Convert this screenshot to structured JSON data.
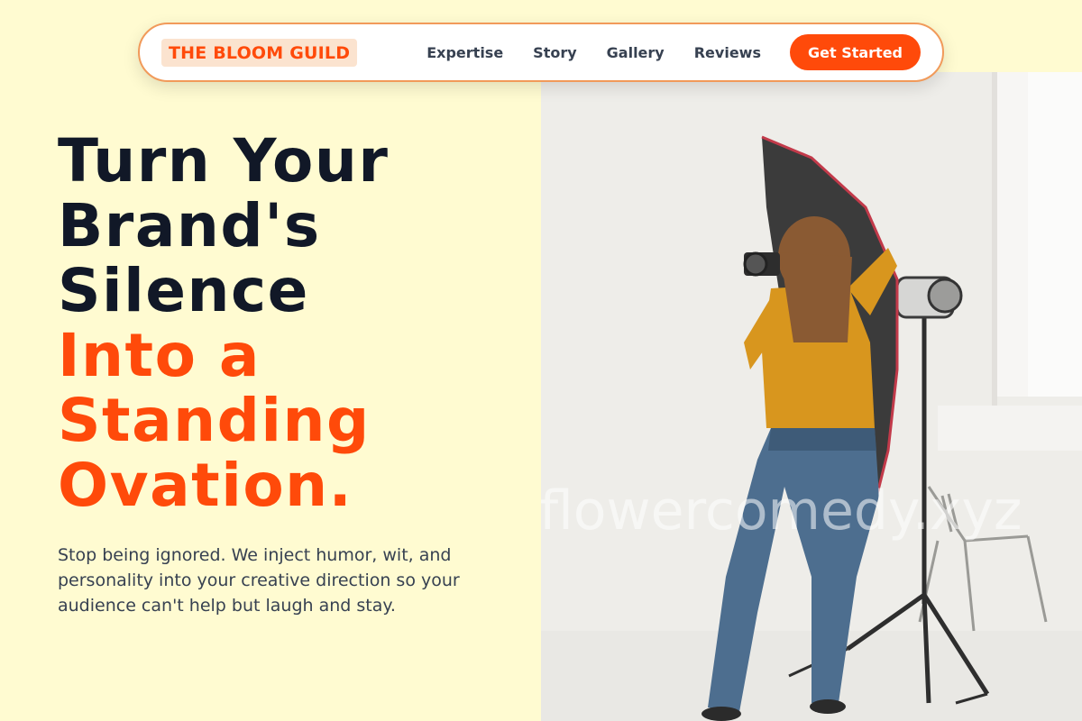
{
  "nav": {
    "logo": "THE BLOOM GUILD",
    "links": [
      "Expertise",
      "Story",
      "Gallery",
      "Reviews"
    ],
    "cta": "Get Started"
  },
  "hero": {
    "headline_dark": [
      "Turn Your",
      "Brand's",
      "Silence"
    ],
    "headline_accent": [
      "Into a",
      "Standing",
      "Ovation."
    ],
    "subtext": "Stop being ignored. We inject humor, wit, and personality into your creative direction so your audience can't help but laugh and stay."
  },
  "photo": {
    "watermark": "flowercomedy.xyz",
    "subject": "photographer-with-softbox"
  },
  "colors": {
    "page_bg": "#fffbd1",
    "accent": "#ff4a0a",
    "heading": "#111827",
    "nav_border": "#f19a5a"
  }
}
